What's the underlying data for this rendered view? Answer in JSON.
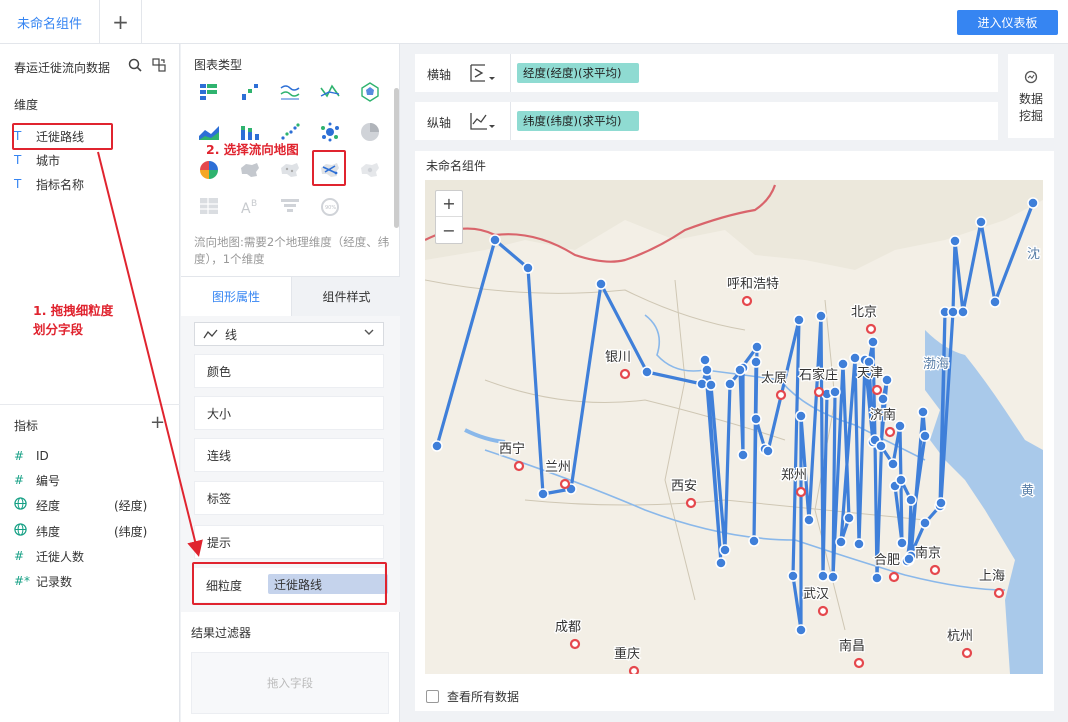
{
  "topbar": {
    "active_tab": "未命名组件",
    "add_tab": "+",
    "enter_dashboard": "进入仪表板"
  },
  "left": {
    "dataset_name": "春运迁徙流向数据",
    "dimension_title": "维度",
    "dimensions": [
      {
        "type": "T",
        "name": "迁徙路线"
      },
      {
        "type": "T",
        "name": "城市"
      },
      {
        "type": "T",
        "name": "指标名称"
      }
    ],
    "metric_title": "指标",
    "metrics": [
      {
        "type": "#",
        "name": "ID",
        "extra": ""
      },
      {
        "type": "#",
        "name": "编号",
        "extra": ""
      },
      {
        "type": "globe",
        "name": "经度",
        "extra": "(经度)"
      },
      {
        "type": "globe",
        "name": "纬度",
        "extra": "(纬度)"
      },
      {
        "type": "#",
        "name": "迁徙人数",
        "extra": ""
      },
      {
        "type": "#*",
        "name": "记录数",
        "extra": ""
      }
    ]
  },
  "middle": {
    "chart_type_title": "图表类型",
    "description": "流向地图:需要2个地理维度（经度、纬度），1个维度",
    "tab_graph": "图形属性",
    "tab_style": "组件样式",
    "line_select": "线",
    "props": [
      "颜色",
      "大小",
      "连线",
      "标签",
      "提示"
    ],
    "granularity_label": "细粒度",
    "granularity_value": "迁徙路线",
    "result_filter_title": "结果过滤器",
    "drop_hint": "拖入字段"
  },
  "axes": {
    "x_label": "横轴",
    "x_field": "经度(经度)(求平均)",
    "y_label": "纵轴",
    "y_field": "纬度(纬度)(求平均)"
  },
  "data_mining": {
    "line1": "数据",
    "line2": "挖掘"
  },
  "widget": {
    "title": "未命名组件",
    "zoom_in": "+",
    "zoom_out": "−",
    "show_all": "查看所有数据"
  },
  "map_labels": [
    {
      "text": "呼和浩特"
    },
    {
      "text": "北京"
    },
    {
      "text": "银川"
    },
    {
      "text": "太原"
    },
    {
      "text": "石家庄"
    },
    {
      "text": "天津"
    },
    {
      "text": "渤海"
    },
    {
      "text": "济南"
    },
    {
      "text": "西宁"
    },
    {
      "text": "兰州"
    },
    {
      "text": "西安"
    },
    {
      "text": "郑州"
    },
    {
      "text": "合肥"
    },
    {
      "text": "南京"
    },
    {
      "text": "上海"
    },
    {
      "text": "武汉"
    },
    {
      "text": "成都"
    },
    {
      "text": "重庆"
    },
    {
      "text": "南昌"
    },
    {
      "text": "杭州"
    },
    {
      "text": "黄"
    },
    {
      "text": "沈"
    }
  ],
  "annotations": {
    "step1_line1": "1. 拖拽细粒度",
    "step1_line2": "划分字段",
    "step2": "2. 选择流向地图"
  },
  "colors": {
    "accent": "#3685f2",
    "annotation": "#e0242f",
    "axis_chip": "#8fdbd2",
    "granularity_chip": "#c5d3ec",
    "flow_line": "#3f7fd9"
  }
}
